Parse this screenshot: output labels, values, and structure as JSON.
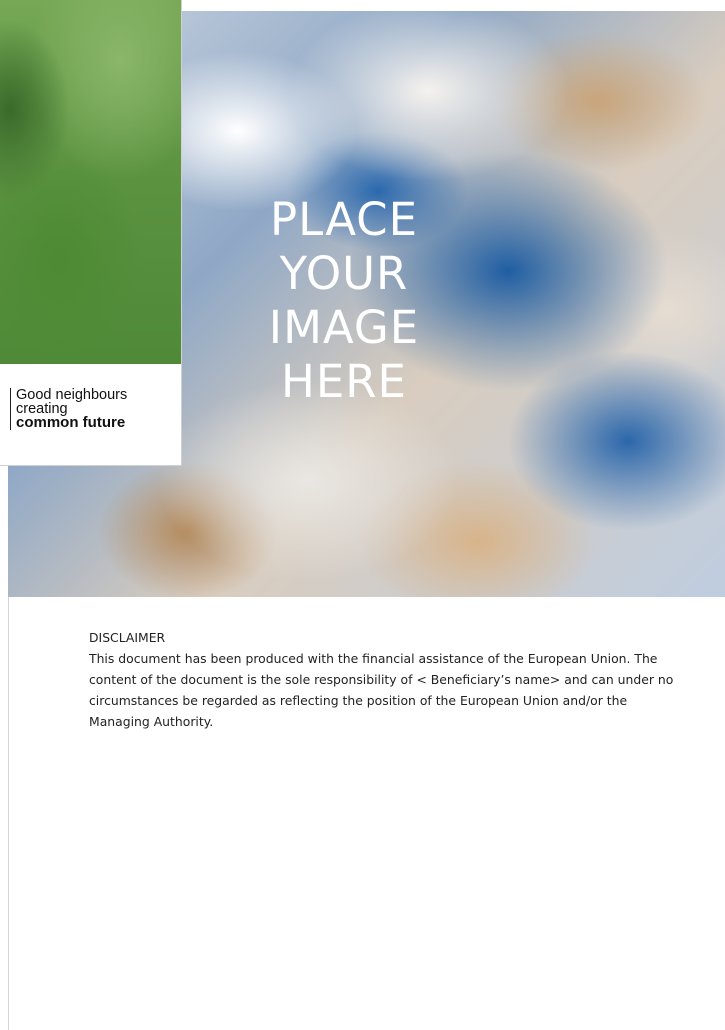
{
  "hero": {
    "placeholder_lines": [
      "PLACE",
      "YOUR",
      "IMAGE",
      "HERE"
    ]
  },
  "tagline": {
    "line1": "Good neighbours",
    "line2": "creating",
    "line3": "common future"
  },
  "disclaimer": {
    "heading": "DISCLAIMER",
    "body": "This document has been produced with the financial assistance of the European Union. The content of the document is the sole responsibility of < Beneficiary’s name> and can under no circumstances be regarded as reflecting the position of the European Union and/or the Managing Authority."
  },
  "colors": {
    "hero_blue": "#1f5ea3",
    "green": "#5a9240",
    "text": "#222222"
  }
}
